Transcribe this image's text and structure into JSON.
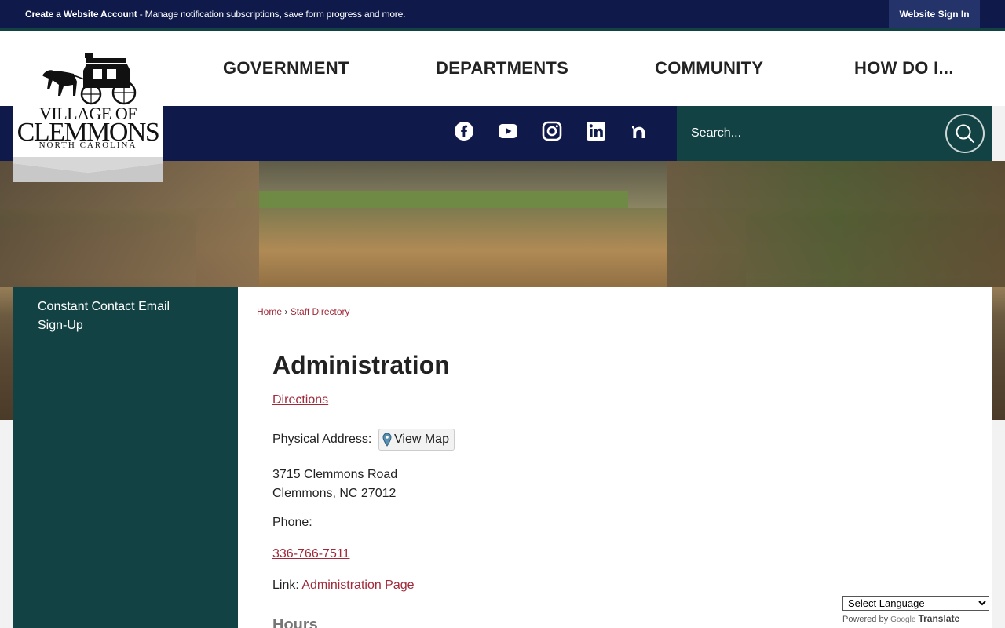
{
  "topbar": {
    "account_link": "Create a Website Account",
    "account_tagline": " - Manage notification subscriptions, save form progress and more.",
    "signin_label": "Website Sign In"
  },
  "logo": {
    "line1": "VILLAGE OF",
    "line2": "CLEMMONS",
    "line3": "NORTH CAROLINA"
  },
  "nav": {
    "items": [
      "GOVERNMENT",
      "DEPARTMENTS",
      "COMMUNITY",
      "HOW DO I..."
    ]
  },
  "social": {
    "icons": [
      "facebook-icon",
      "youtube-icon",
      "instagram-icon",
      "linkedin-icon",
      "nextdoor-icon"
    ]
  },
  "search": {
    "placeholder": "Search..."
  },
  "sidebar": {
    "link": "Constant Contact Email Sign-Up"
  },
  "breadcrumb": {
    "home": "Home",
    "separator": "›",
    "current": "Staff Directory"
  },
  "main": {
    "title": "Administration",
    "directions": "Directions",
    "physical_address_label": "Physical Address:",
    "view_map": "View Map",
    "address_line1": "3715 Clemmons Road",
    "address_line2": "Clemmons, NC 27012",
    "phone_label": "Phone:",
    "phone": "336-766-7511",
    "link_label": "Link:",
    "link_text": "Administration Page",
    "hours_heading": "Hours"
  },
  "translate": {
    "select_label": "Select Language",
    "powered_by": "Powered by",
    "google": "Google",
    "translate": "Translate"
  },
  "colors": {
    "navy": "#0f1a4a",
    "teal": "#134244",
    "link_red": "#a02a3a"
  }
}
